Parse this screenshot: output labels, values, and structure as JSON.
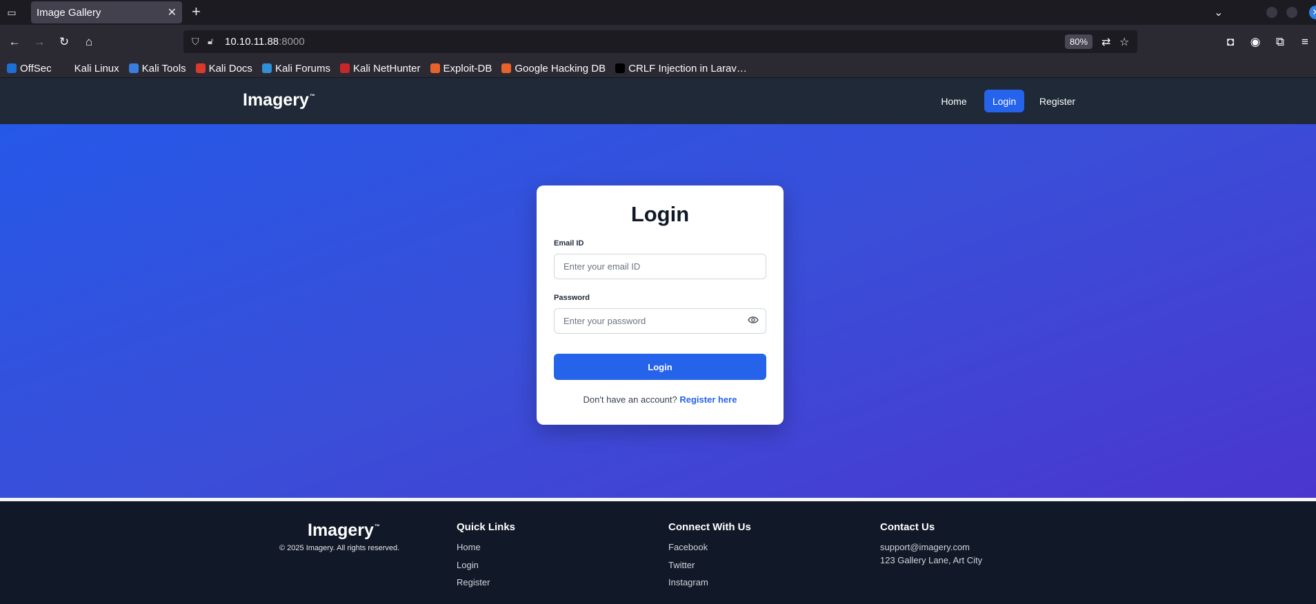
{
  "browser": {
    "tab_title": "Image Gallery",
    "url_host": "10.10.11.88",
    "url_port": ":8000",
    "zoom": "80%",
    "bookmarks": [
      {
        "label": "OffSec",
        "icon": "offsec-icon",
        "color": "#1d6fd6"
      },
      {
        "label": "Kali Linux",
        "icon": "kali-dragon-icon",
        "color": "#2b2a33"
      },
      {
        "label": "Kali Tools",
        "icon": "kali-tools-icon",
        "color": "#3b7ddd"
      },
      {
        "label": "Kali Docs",
        "icon": "kali-docs-icon",
        "color": "#d93a2b"
      },
      {
        "label": "Kali Forums",
        "icon": "kali-forums-icon",
        "color": "#2f8fd8"
      },
      {
        "label": "Kali NetHunter",
        "icon": "nethunter-icon",
        "color": "#c62828"
      },
      {
        "label": "Exploit-DB",
        "icon": "exploit-db-icon",
        "color": "#e8632b"
      },
      {
        "label": "Google Hacking DB",
        "icon": "ghdb-icon",
        "color": "#e8632b"
      },
      {
        "label": "CRLF Injection in Larav…",
        "icon": "dev-icon",
        "color": "#000000"
      }
    ]
  },
  "site": {
    "logo": "Imagery",
    "logo_tm": "™",
    "nav": {
      "home": "Home",
      "login": "Login",
      "register": "Register"
    }
  },
  "login_form": {
    "title": "Login",
    "email_label": "Email ID",
    "email_placeholder": "Enter your email ID",
    "password_label": "Password",
    "password_placeholder": "Enter your password",
    "submit_label": "Login",
    "no_account_text": "Don't have an account?",
    "register_link": "Register here"
  },
  "footer": {
    "logo": "Imagery",
    "logo_tm": "™",
    "copyright": "© 2025 Imagery. All rights reserved.",
    "quick_links_heading": "Quick Links",
    "quick_links": [
      "Home",
      "Login",
      "Register"
    ],
    "connect_heading": "Connect With Us",
    "connect_links": [
      "Facebook",
      "Twitter",
      "Instagram"
    ],
    "contact_heading": "Contact Us",
    "contact_email": "support@imagery.com",
    "contact_address": "123 Gallery Lane, Art City"
  },
  "colors": {
    "accent": "#2563eb",
    "header_bg": "#1f2937",
    "footer_bg": "#111827"
  }
}
